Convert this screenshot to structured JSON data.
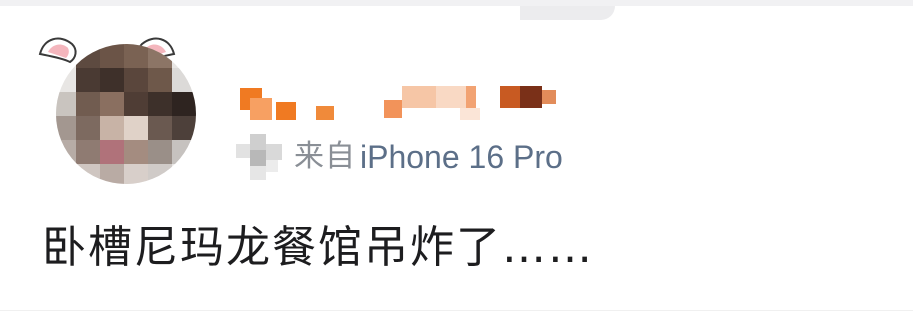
{
  "post": {
    "author": {
      "avatar_icon": "pixelated-avatar-with-bunny-ears",
      "username_icon": "pixelated-username"
    },
    "source_prefix": "来自",
    "source_device": "iPhone 16 Pro",
    "text": "卧槽尼玛龙餐馆吊炸了……"
  },
  "colors": {
    "source_prefix": "#8a8f96",
    "source_device": "#5c6f88",
    "post_text": "#1d1d1f",
    "username_accent": "#f07a22"
  }
}
